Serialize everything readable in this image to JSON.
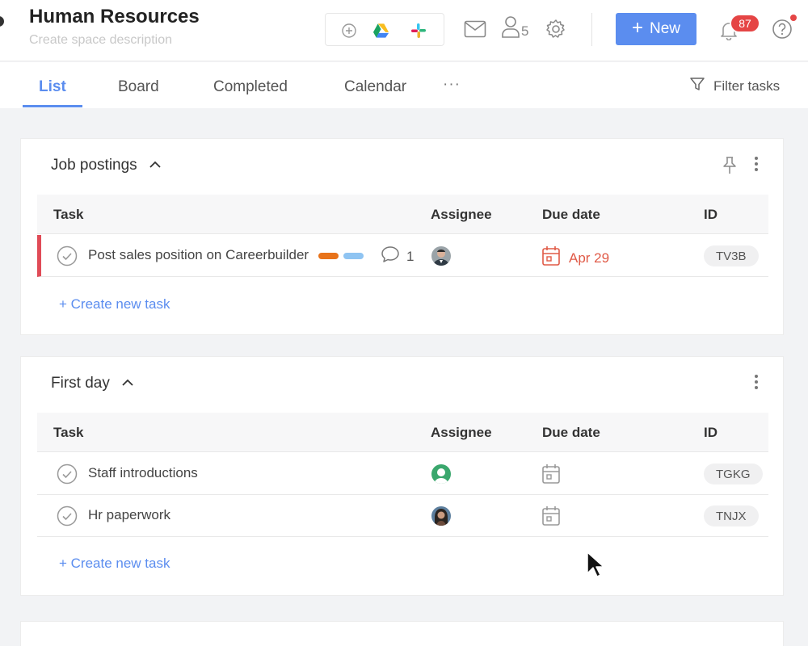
{
  "header": {
    "title": "Human Resources",
    "description_placeholder": "Create space description",
    "members_count": "5",
    "new_button_label": "New",
    "notifications_count": "87",
    "integrations": [
      "add-integration-icon",
      "google-drive-icon",
      "slack-icon"
    ]
  },
  "tabs": [
    {
      "label": "List",
      "active": true
    },
    {
      "label": "Board",
      "active": false
    },
    {
      "label": "Completed",
      "active": false
    },
    {
      "label": "Calendar",
      "active": false
    }
  ],
  "more_tabs_label": "···",
  "filter_label": "Filter tasks",
  "columns": {
    "task": "Task",
    "assignee": "Assignee",
    "due_date": "Due date",
    "id": "ID"
  },
  "sections": [
    {
      "name": "Job postings",
      "create_label": "+ Create new task",
      "tasks": [
        {
          "name": "Post sales position on Careerbuilder",
          "tags": [
            "#e8731a",
            "#8fc4f2"
          ],
          "comments": "1",
          "due": "Apr 29",
          "due_overdue": true,
          "id": "TV3B",
          "priority": true
        }
      ]
    },
    {
      "name": "First day",
      "create_label": "+ Create new task",
      "tasks": [
        {
          "name": "Staff introductions",
          "due": "",
          "id": "TGKG"
        },
        {
          "name": "Hr paperwork",
          "due": "",
          "id": "TNJX"
        }
      ]
    }
  ],
  "colors": {
    "accent": "#5b8def",
    "overdue": "#e05a47",
    "priority": "#e04b57",
    "badge": "#e54545"
  }
}
